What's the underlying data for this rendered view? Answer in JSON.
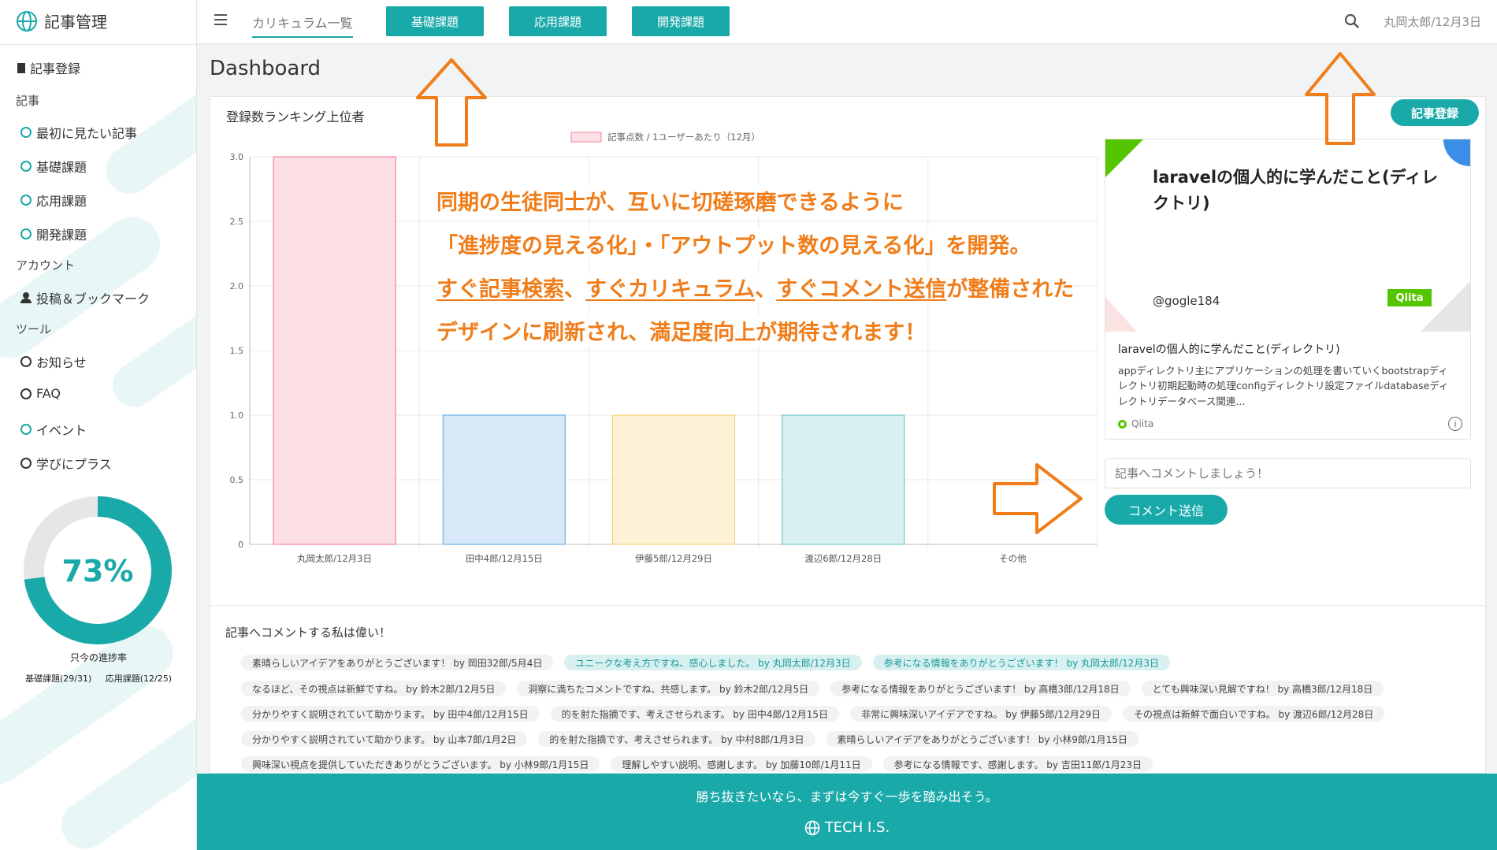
{
  "sidebar": {
    "app_title": "記事管理",
    "register": "記事登録",
    "section_articles": "記事",
    "article_items": [
      {
        "label": "最初に見たい記事"
      },
      {
        "label": "基礎課題"
      },
      {
        "label": "応用課題"
      },
      {
        "label": "開発課題"
      }
    ],
    "section_account": "アカウント",
    "account_item": "投稿＆ブックマーク",
    "section_tools": "ツール",
    "tool_items": [
      {
        "label": "お知らせ",
        "color": "dark"
      },
      {
        "label": "FAQ",
        "color": "dark"
      },
      {
        "label": "イベント",
        "color": "teal"
      },
      {
        "label": "学びにプラス",
        "color": "dark"
      }
    ],
    "progress": {
      "percent_text": "73%",
      "value": 0.73,
      "label": "只今の進捗率",
      "basic": "基礎課題(29/31)",
      "advanced": "応用課題(12/25)"
    }
  },
  "topbar": {
    "current_link": "カリキュラム一覧",
    "buttons": [
      "基礎課題",
      "応用課題",
      "開発課題"
    ],
    "user_date": "丸岡太郎/12月3日"
  },
  "main": {
    "dashboard_title": "Dashboard",
    "card_title": "登録数ランキング上位者",
    "add_article": "記事登録",
    "comment_placeholder": "記事へコメントしましょう！",
    "comment_send": "コメント送信"
  },
  "chart_data": {
    "type": "bar",
    "legend": "記事点数 / 1ユーザーあたり（12月）",
    "categories": [
      "丸岡太郎/12月3日",
      "田中4郎/12月15日",
      "伊藤5郎/12月29日",
      "渡辺6郎/12月28日",
      "その他"
    ],
    "values": [
      3,
      1,
      1,
      1,
      0
    ],
    "ylim": [
      0,
      3
    ],
    "yticks": [
      "0",
      "0.5",
      "1.0",
      "1.5",
      "2.0",
      "2.5",
      "3.0"
    ],
    "grid": true,
    "colors": {
      "fills": [
        "#fde0e6",
        "#d7e9f8",
        "#fdf1d6",
        "#d8f0f0",
        "#eeeeee"
      ],
      "strokes": [
        "#f0849a",
        "#6aaee6",
        "#f7cf79",
        "#74c8c8",
        "#cccccc"
      ]
    }
  },
  "preview": {
    "image_title": "laravelの個人的に学んだこと(ディレクトリ)",
    "author": "@gogle184",
    "badge": "Qiita",
    "title": "laravelの個人的に学んだこと(ディレクトリ)",
    "description": "appディレクトリ主にアプリケーションの処理を書いていくbootstrapディレクトリ初期起動時の処理configディレクトリ設定ファイルdatabaseディレクトリデータベース関連...",
    "source": "Qiita",
    "info": "i"
  },
  "annotation": {
    "line1": "同期の生徒同士が、互いに切磋琢磨できるように",
    "line2": "「進捗度の見える化」・「アウトプット数の見える化」を開発。",
    "line3_a": "すぐ記事検索",
    "sep1": "、",
    "line3_b": "すぐカリキュラム",
    "sep2": "、",
    "line3_c": "すぐコメント送信",
    "line3_d": "が整備された",
    "line4": "デザインに刷新され、満足度向上が期待されます！"
  },
  "comments": {
    "title": "記事へコメントする私は偉い！",
    "rows": [
      [
        {
          "text": "素晴らしいアイデアをありがとうございます！ by 岡田32郎/5月4日",
          "hl": false
        },
        {
          "text": "ユニークな考え方ですね、感心しました。 by 丸岡太郎/12月3日",
          "hl": true
        },
        {
          "text": "参考になる情報をありがとうございます！ by 丸岡太郎/12月3日",
          "hl": true
        }
      ],
      [
        {
          "text": "なるほど、その視点は新鮮ですね。 by 鈴木2郎/12月5日",
          "hl": false
        },
        {
          "text": "洞察に満ちたコメントですね、共感します。 by 鈴木2郎/12月5日",
          "hl": false
        },
        {
          "text": "参考になる情報をありがとうございます！ by 高橋3郎/12月18日",
          "hl": false
        },
        {
          "text": "とても興味深い見解ですね！ by 高橋3郎/12月18日",
          "hl": false
        }
      ],
      [
        {
          "text": "分かりやすく説明されていて助かります。 by 田中4郎/12月15日",
          "hl": false
        },
        {
          "text": "的を射た指摘です、考えさせられます。 by 田中4郎/12月15日",
          "hl": false
        },
        {
          "text": "非常に興味深いアイデアですね。 by 伊藤5郎/12月29日",
          "hl": false
        },
        {
          "text": "その視点は新鮮で面白いですね。 by 渡辺6郎/12月28日",
          "hl": false
        }
      ],
      [
        {
          "text": "分かりやすく説明されていて助かります。 by 山本7郎/1月2日",
          "hl": false
        },
        {
          "text": "的を射た指摘です、考えさせられます。 by 中村8郎/1月3日",
          "hl": false
        },
        {
          "text": "素晴らしいアイデアをありがとうございます！ by 小林9郎/1月15日",
          "hl": false
        }
      ],
      [
        {
          "text": "興味深い視点を提供していただきありがとうございます。 by 小林9郎/1月15日",
          "hl": false
        },
        {
          "text": "理解しやすい説明、感謝します。 by 加藤10郎/1月11日",
          "hl": false
        },
        {
          "text": "参考になる情報です、感謝します。 by 吉田11郎/1月23日",
          "hl": false
        }
      ]
    ]
  },
  "footer": {
    "message": "勝ち抜きたいなら、まずは今すぐ一歩を踏み出そう。",
    "brand": "TECH I.S."
  },
  "colors": {
    "accent": "#1aa9a9",
    "annotation": "#f07d1a"
  }
}
